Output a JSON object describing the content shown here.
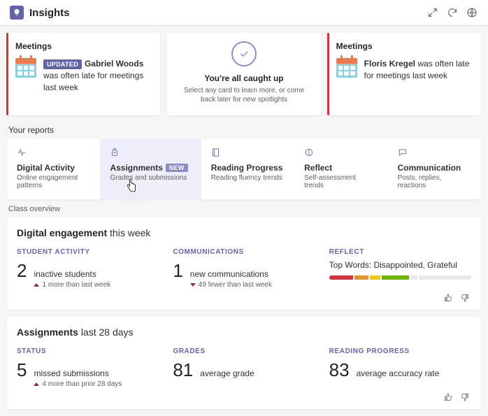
{
  "header": {
    "title": "Insights",
    "icon": "lightbulb-icon",
    "actions": [
      "expand-icon",
      "refresh-icon",
      "globe-icon"
    ]
  },
  "spotlights": {
    "left": {
      "heading": "Meetings",
      "badge": "UPDATED",
      "person": "Gabriel Woods",
      "suffix": " was often late for meetings last week"
    },
    "center": {
      "title": "You're all caught up",
      "subtitle": "Select any card to learn more, or come back later for new spotlights"
    },
    "right": {
      "heading": "Meetings",
      "person": "Floris Kregel",
      "suffix": " was often late for meetings last week"
    }
  },
  "reports": {
    "heading": "Your reports",
    "tabs": [
      {
        "title": "Digital Activity",
        "sub": "Online engagement patterns",
        "icon": "pulse-icon"
      },
      {
        "title": "Assignments",
        "sub": "Grades and submissions",
        "icon": "backpack-icon",
        "badge": "NEW",
        "active": true
      },
      {
        "title": "Reading Progress",
        "sub": "Reading fluency trends",
        "icon": "book-icon"
      },
      {
        "title": "Reflect",
        "sub": "Self-assessment trends",
        "icon": "mirror-icon"
      },
      {
        "title": "Communication",
        "sub": "Posts, replies, reactions",
        "icon": "chat-icon"
      }
    ]
  },
  "overview_label": "Class overview",
  "digital": {
    "title_bold": "Digital engagement",
    "title_rest": "this week",
    "activity": {
      "label": "STUDENT ACTIVITY",
      "value": "2",
      "text": "inactive students",
      "delta": "1 more than last week",
      "direction": "up"
    },
    "comms": {
      "label": "COMMUNICATIONS",
      "value": "1",
      "text": "new communications",
      "delta": "49 fewer than last week",
      "direction": "down"
    },
    "reflect": {
      "label": "REFLECT",
      "text": "Top Words: Disappointed, Grateful",
      "bars": [
        {
          "w": "18%",
          "c": "#d13438"
        },
        {
          "w": "10%",
          "c": "#e8912d"
        },
        {
          "w": "8%",
          "c": "#f2c811"
        },
        {
          "w": "20%",
          "c": "#6bb700"
        },
        {
          "w": "5%",
          "c": "#e8e8e8"
        },
        {
          "w": "39%",
          "c": "#e8e8e8"
        }
      ]
    }
  },
  "assignments": {
    "title_bold": "Assignments",
    "title_rest": "last 28 days",
    "status": {
      "label": "STATUS",
      "value": "5",
      "text": "missed submissions",
      "delta": "4 more than prior 28 days",
      "direction": "up"
    },
    "grades": {
      "label": "GRADES",
      "value": "81",
      "text": "average grade"
    },
    "reading": {
      "label": "READING PROGRESS",
      "value": "83",
      "text": "average accuracy rate"
    }
  }
}
